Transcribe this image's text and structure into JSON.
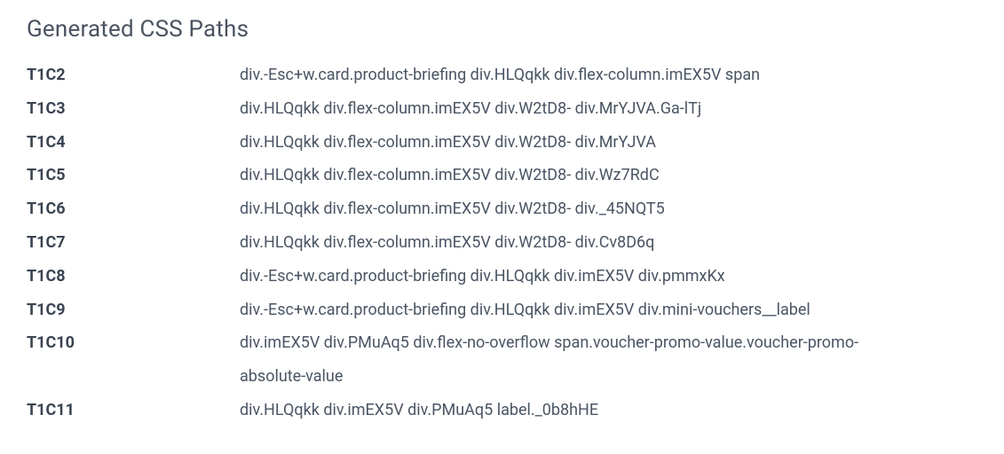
{
  "title": "Generated CSS Paths",
  "rows": [
    {
      "id": "T1C2",
      "path": "div.-Esc+w.card.product-briefing div.HLQqkk div.flex-column.imEX5V span"
    },
    {
      "id": "T1C3",
      "path": "div.HLQqkk div.flex-column.imEX5V div.W2tD8- div.MrYJVA.Ga-lTj"
    },
    {
      "id": "T1C4",
      "path": "div.HLQqkk div.flex-column.imEX5V div.W2tD8- div.MrYJVA"
    },
    {
      "id": "T1C5",
      "path": "div.HLQqkk div.flex-column.imEX5V div.W2tD8- div.Wz7RdC"
    },
    {
      "id": "T1C6",
      "path": "div.HLQqkk div.flex-column.imEX5V div.W2tD8- div._45NQT5"
    },
    {
      "id": "T1C7",
      "path": "div.HLQqkk div.flex-column.imEX5V div.W2tD8- div.Cv8D6q"
    },
    {
      "id": "T1C8",
      "path": "div.-Esc+w.card.product-briefing div.HLQqkk div.imEX5V div.pmmxKx"
    },
    {
      "id": "T1C9",
      "path": "div.-Esc+w.card.product-briefing div.HLQqkk div.imEX5V div.mini-vouchers__label"
    },
    {
      "id": "T1C10",
      "path": "div.imEX5V div.PMuAq5 div.flex-no-overflow span.voucher-promo-value.voucher-promo-",
      "path_cont": "absolute-value"
    },
    {
      "id": "T1C11",
      "path": "div.HLQqkk div.imEX5V div.PMuAq5 label._0b8hHE"
    }
  ]
}
